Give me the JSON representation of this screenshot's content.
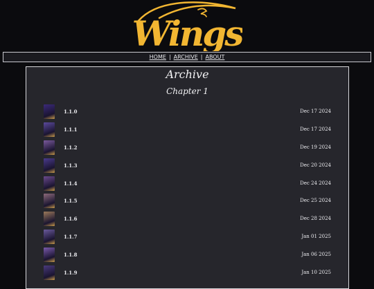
{
  "logo": {
    "text": "Wings"
  },
  "nav": {
    "home": "HOME",
    "archive": "ARCHIVE",
    "about": "ABOUT",
    "separator": "|"
  },
  "page": {
    "title": "Archive",
    "chapter": "Chapter 1"
  },
  "pages": [
    {
      "label": "1.1.0",
      "date": "Dec 17 2024",
      "thumb_color": "#3b2a7a"
    },
    {
      "label": "1.1.1",
      "date": "Dec 17 2024",
      "thumb_color": "#5b4a9c"
    },
    {
      "label": "1.1.2",
      "date": "Dec 19 2024",
      "thumb_color": "#7a5a9c"
    },
    {
      "label": "1.1.3",
      "date": "Dec 20 2024",
      "thumb_color": "#4a3a8c"
    },
    {
      "label": "1.1.4",
      "date": "Dec 24 2024",
      "thumb_color": "#6b4a8c"
    },
    {
      "label": "1.1.5",
      "date": "Dec 25 2024",
      "thumb_color": "#8c6a7a"
    },
    {
      "label": "1.1.6",
      "date": "Dec 28 2024",
      "thumb_color": "#9c7a5a"
    },
    {
      "label": "1.1.7",
      "date": "Jan 01 2025",
      "thumb_color": "#6a5a9c"
    },
    {
      "label": "1.1.8",
      "date": "Jan 06 2025",
      "thumb_color": "#7a5aac"
    },
    {
      "label": "1.1.9",
      "date": "Jan 10 2025",
      "thumb_color": "#4a3a7c"
    }
  ],
  "colors": {
    "logo": "#f2b632",
    "panel": "#26262c",
    "background": "#0b0b0e"
  }
}
